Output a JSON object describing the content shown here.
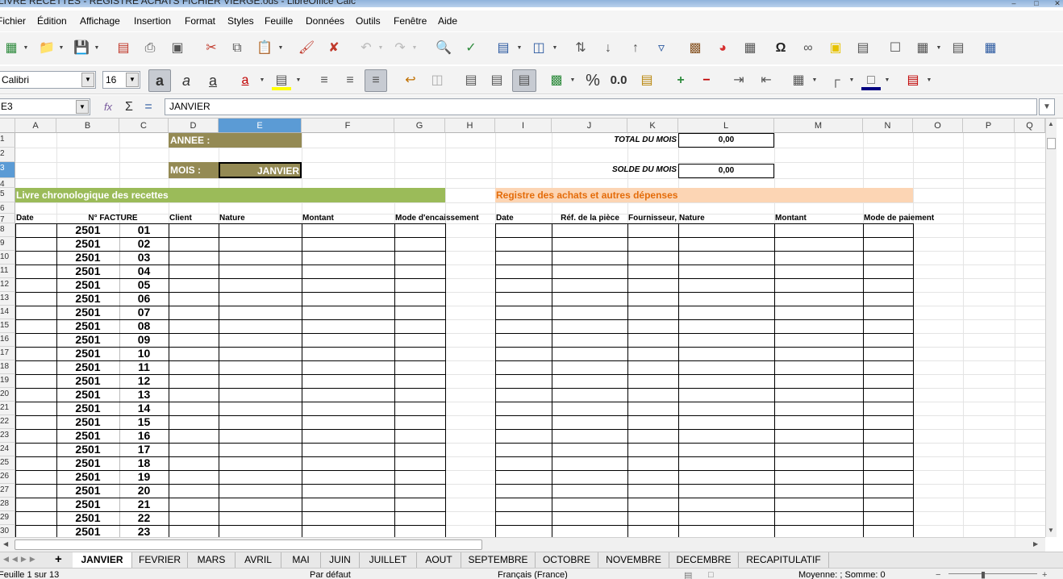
{
  "window": {
    "title": "LIVRE RECETTES - REGISTRE ACHATS FICHIER VIERGE.ods - LibreOffice Calc"
  },
  "menu": [
    "Fichier",
    "Édition",
    "Affichage",
    "Insertion",
    "Format",
    "Styles",
    "Feuille",
    "Données",
    "Outils",
    "Fenêtre",
    "Aide"
  ],
  "toolbar": {
    "font_name": "Calibri",
    "font_size": "16",
    "percent": "%",
    "decimal": "0.0"
  },
  "formula_bar": {
    "name_box": "E3",
    "content": "JANVIER"
  },
  "columns": [
    "A",
    "B",
    "C",
    "D",
    "E",
    "F",
    "G",
    "H",
    "I",
    "J",
    "K",
    "L",
    "M",
    "N",
    "O",
    "P",
    "Q"
  ],
  "active_column": "E",
  "active_row": 3,
  "rows": [
    "1",
    "2",
    "3",
    "4",
    "5",
    "6",
    "7",
    "8",
    "9",
    "10",
    "11",
    "12",
    "13",
    "14",
    "15",
    "16",
    "17",
    "18",
    "19",
    "20",
    "21",
    "22",
    "23",
    "24",
    "25",
    "26",
    "27",
    "28",
    "29",
    "30"
  ],
  "sheet": {
    "annee_label": "ANNEE :",
    "mois_label": "MOIS :",
    "mois_value": "JANVIER",
    "total_label": "TOTAL DU MOIS",
    "total_value": "0,00",
    "solde_label": "SOLDE DU MOIS",
    "solde_value": "0,00",
    "recettes_title": "Livre chronologique des recettes",
    "achats_title": "Registre des achats et autres dépenses",
    "recettes_headers": {
      "date": "Date",
      "facture": "N° FACTURE",
      "client": "Client",
      "nature": "Nature",
      "montant": "Montant",
      "mode": "Mode d'encaissement"
    },
    "achats_headers": {
      "date": "Date",
      "ref": "Réf. de la pièce",
      "fournisseur": "Fournisseur,",
      "nature": "Nature",
      "montant": "Montant",
      "mode": "Mode de paiement"
    },
    "invoices": [
      {
        "year": "2501",
        "num": "01"
      },
      {
        "year": "2501",
        "num": "02"
      },
      {
        "year": "2501",
        "num": "03"
      },
      {
        "year": "2501",
        "num": "04"
      },
      {
        "year": "2501",
        "num": "05"
      },
      {
        "year": "2501",
        "num": "06"
      },
      {
        "year": "2501",
        "num": "07"
      },
      {
        "year": "2501",
        "num": "08"
      },
      {
        "year": "2501",
        "num": "09"
      },
      {
        "year": "2501",
        "num": "10"
      },
      {
        "year": "2501",
        "num": "11"
      },
      {
        "year": "2501",
        "num": "12"
      },
      {
        "year": "2501",
        "num": "13"
      },
      {
        "year": "2501",
        "num": "14"
      },
      {
        "year": "2501",
        "num": "15"
      },
      {
        "year": "2501",
        "num": "16"
      },
      {
        "year": "2501",
        "num": "17"
      },
      {
        "year": "2501",
        "num": "18"
      },
      {
        "year": "2501",
        "num": "19"
      },
      {
        "year": "2501",
        "num": "20"
      },
      {
        "year": "2501",
        "num": "21"
      },
      {
        "year": "2501",
        "num": "22"
      },
      {
        "year": "2501",
        "num": "23"
      }
    ]
  },
  "tabs": [
    "JANVIER",
    "FEVRIER",
    "MARS",
    "AVRIL",
    "MAI",
    "JUIN",
    "JUILLET",
    "AOUT",
    "SEPTEMBRE",
    "OCTOBRE",
    "NOVEMBRE",
    "DECEMBRE",
    "RECAPITULATIF"
  ],
  "active_tab": "JANVIER",
  "status": {
    "sheet_info": "Feuille 1 sur 13",
    "page_style": "Par défaut",
    "language": "Français (France)",
    "sum": "Moyenne: ; Somme: 0"
  },
  "colors": {
    "olive": "#948a54",
    "green": "#9bbb59",
    "peach": "#fcd5b4",
    "orange_text": "#e46c0a",
    "selection": "#5b9bd5"
  }
}
